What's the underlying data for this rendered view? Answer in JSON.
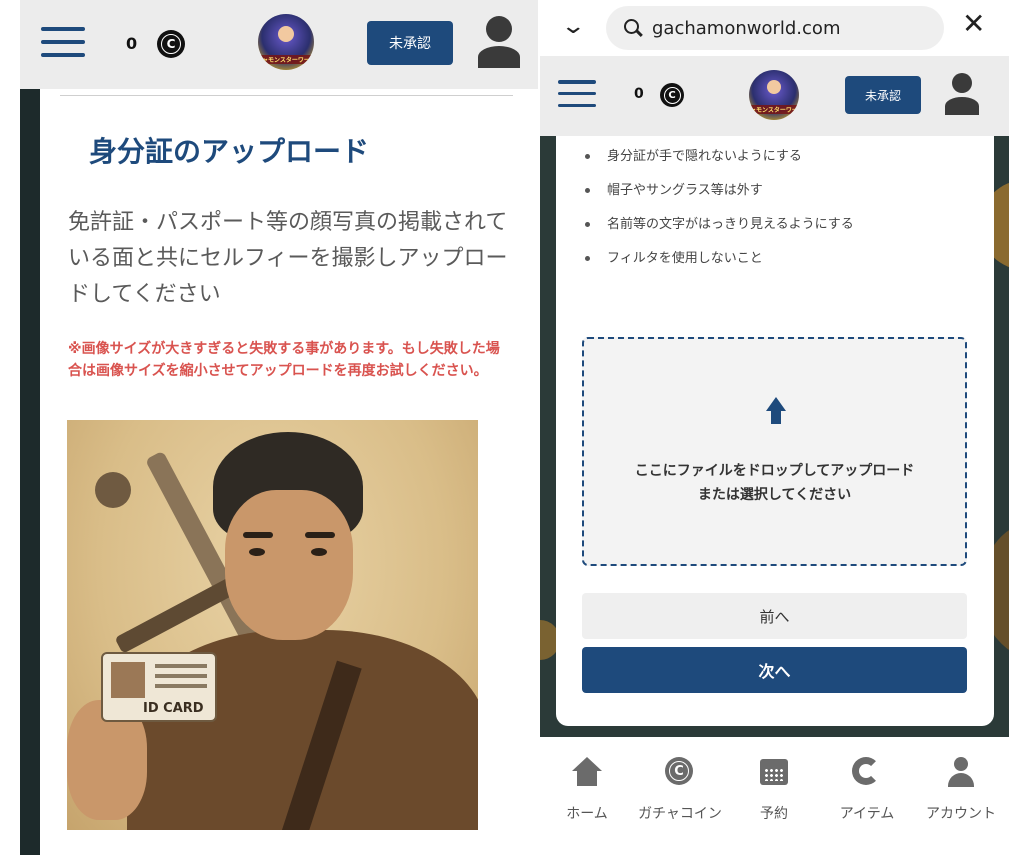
{
  "left": {
    "header": {
      "coin_count": "0",
      "coin_symbol": "C",
      "logo_text": "ガチャモンスターワールド",
      "status_label": "未承認"
    },
    "title": "身分証のアップロード",
    "description": "免許証・パスポート等の顔写真の掲載されている面と共にセルフィーを撮影しアップロードしてください",
    "warning": "※画像サイズが大きすぎると失敗する事があります。もし失敗した場合は画像サイズを縮小させてアップロードを再度お試しください。",
    "illustration": {
      "card_text": "ID CARD"
    }
  },
  "right": {
    "browser": {
      "url": "gachamonworld.com"
    },
    "header": {
      "coin_count": "0",
      "coin_symbol": "C",
      "logo_text": "ガチャモンスターワールド",
      "status_label": "未承認"
    },
    "tips": [
      "身分証が手で隠れないようにする",
      "帽子やサングラス等は外す",
      "名前等の文字がはっきり見えるようにする",
      "フィルタを使用しないこと"
    ],
    "dropzone": {
      "line1": "ここにファイルをドロップしてアップロード",
      "line2": "または選択してください"
    },
    "buttons": {
      "prev": "前へ",
      "next": "次へ"
    },
    "bottom_nav": [
      {
        "label": "ホーム",
        "icon": "home-icon"
      },
      {
        "label": "ガチャコイン",
        "icon": "coin-icon"
      },
      {
        "label": "予約",
        "icon": "calendar-icon"
      },
      {
        "label": "アイテム",
        "icon": "item-icon"
      },
      {
        "label": "アカウント",
        "icon": "account-icon"
      }
    ]
  },
  "colors": {
    "primary": "#1e4a7c",
    "warning": "#d9534f",
    "header_bg": "#ececec"
  }
}
